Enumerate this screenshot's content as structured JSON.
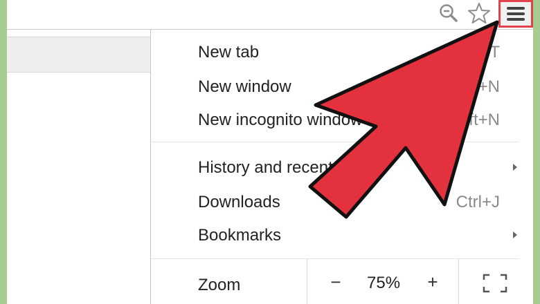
{
  "toolbar": {
    "icons": [
      "zoom-icon",
      "star-icon",
      "chrome-menu-icon"
    ],
    "menu_highlight_color": "#e0434b"
  },
  "menu": {
    "items": [
      {
        "label": "New tab",
        "shortcut": "Ctrl+T"
      },
      {
        "label": "New window",
        "shortcut": "Ctrl+N"
      },
      {
        "label": "New incognito window",
        "shortcut": "Ctrl+Shift+N"
      },
      {
        "label": "History and recent tabs",
        "has_submenu": true
      },
      {
        "label": "Downloads",
        "shortcut": "Ctrl+J"
      },
      {
        "label": "Bookmarks",
        "has_submenu": true
      }
    ],
    "zoom": {
      "label": "Zoom",
      "minus": "−",
      "value": "75%",
      "plus": "+"
    }
  },
  "overlay": {
    "arrow_color": "#e3323e",
    "arrow_outline": "#111111"
  }
}
